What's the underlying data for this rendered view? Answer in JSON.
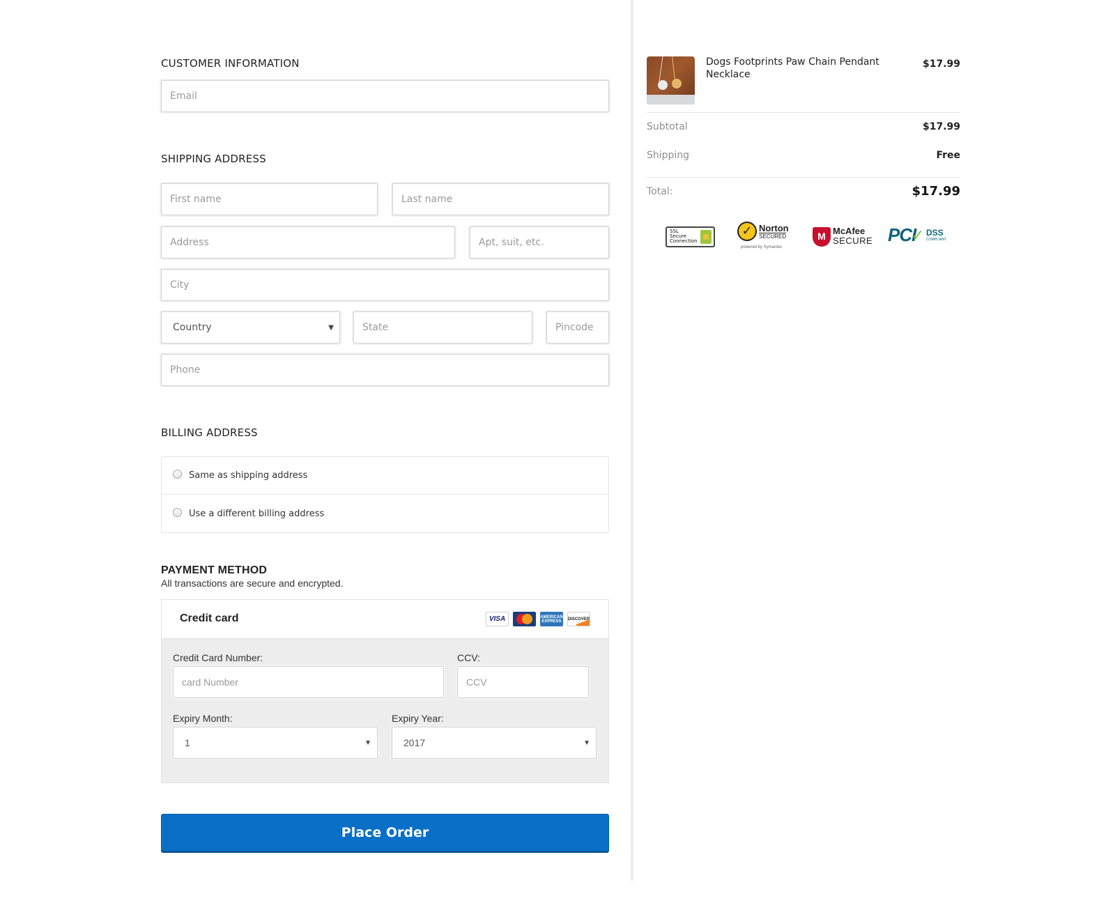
{
  "customer": {
    "heading": "CUSTOMER INFORMATION",
    "email_placeholder": "Email"
  },
  "shipping": {
    "heading": "SHIPPING ADDRESS",
    "first_name_placeholder": "First name",
    "last_name_placeholder": "Last name",
    "address_placeholder": "Address",
    "apt_placeholder": "Apt, suit, etc.",
    "city_placeholder": "City",
    "country_selected": "Country",
    "state_placeholder": "State",
    "pincode_placeholder": "Pincode",
    "phone_placeholder": "Phone"
  },
  "billing": {
    "heading": "BILLING ADDRESS",
    "options": [
      {
        "label": "Same as shipping address",
        "selected": false
      },
      {
        "label": "Use a different billing address",
        "selected": false
      }
    ]
  },
  "payment": {
    "heading": "PAYMENT METHOD",
    "subtext": "All transactions are secure and encrypted.",
    "method_label": "Credit card",
    "card_brands": [
      {
        "name": "visa-icon",
        "text": "VISA"
      },
      {
        "name": "mastercard-icon",
        "text": "MasterCard"
      },
      {
        "name": "amex-icon",
        "text": "AMERICAN EXPRESS"
      },
      {
        "name": "discover-icon",
        "text": "DISCOVER"
      }
    ],
    "card_number_label": "Credit Card Number:",
    "card_number_placeholder": "card Number",
    "ccv_label": "CCV:",
    "ccv_placeholder": "CCV",
    "expiry_month_label": "Expiry Month:",
    "expiry_month_value": "1",
    "expiry_year_label": "Expiry Year:",
    "expiry_year_value": "2017"
  },
  "place_order_label": "Place Order",
  "order_summary": {
    "product_name": "Dogs Footprints Paw Chain Pendant Necklace",
    "product_price": "$17.99",
    "subtotal_label": "Subtotal",
    "subtotal_value": "$17.99",
    "shipping_label": "Shipping",
    "shipping_value": "Free",
    "total_label": "Total:",
    "total_value": "$17.99"
  },
  "trust_badges": {
    "ssl": {
      "line1": "SSL",
      "line2": "Secure",
      "line3": "Connection"
    },
    "norton": {
      "title": "Norton",
      "sub": "SECURED",
      "powered": "powered by Symantec"
    },
    "mcafee": {
      "title": "McAfee",
      "sub": "SECURE"
    },
    "pci": {
      "title": "PCI",
      "dss": "DSS",
      "compliant": "COMPLIANT"
    }
  },
  "colors": {
    "primary_button": "#0a6fc6",
    "divider": "#ededed",
    "panel_bg": "#ededed"
  }
}
